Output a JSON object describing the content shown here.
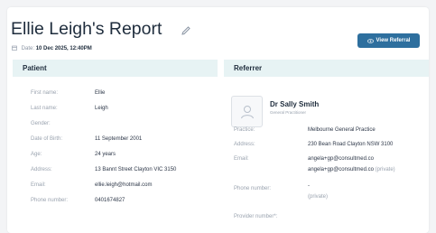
{
  "report": {
    "title": "Ellie Leigh's Report",
    "date_label": "Date:",
    "date_value": "10 Dec 2025, 12:40PM",
    "view_button": "View Referral"
  },
  "colors": {
    "accent": "#2e6f9e",
    "section_bg": "#e7f3f4"
  },
  "patient": {
    "heading": "Patient",
    "fields": [
      {
        "label": "First name:",
        "value": "Ellie"
      },
      {
        "label": "Last name:",
        "value": "Leigh"
      },
      {
        "label": "Gender:",
        "value": ""
      },
      {
        "label": "Date of Birth:",
        "value": "11 September 2001"
      },
      {
        "label": "Age:",
        "value": "24 years"
      },
      {
        "label": "Address:",
        "value": "13 Bannt Street Clayton VIC 3150"
      },
      {
        "label": "Email:",
        "value": "ellie.leigh@hotmail.com"
      },
      {
        "label": "Phone number:",
        "value": "0401674827"
      }
    ]
  },
  "referrer": {
    "heading": "Referrer",
    "name": "Dr Sally Smith",
    "role": "General Practitioner",
    "practice_label": "Practice:",
    "practice_value": "Melbourne General Practice",
    "address_label": "Address:",
    "address_value": "230 Bean Road Clayton NSW 3100",
    "email_label": "Email:",
    "email_value": "angela+gp@consultmed.co",
    "email_value2": "angela+gp@consultmed.co",
    "email_private": "(private)",
    "phone_label": "Phone number:",
    "phone_value": "-",
    "phone_private": "(private)",
    "provider_label": "Provider number*:"
  }
}
